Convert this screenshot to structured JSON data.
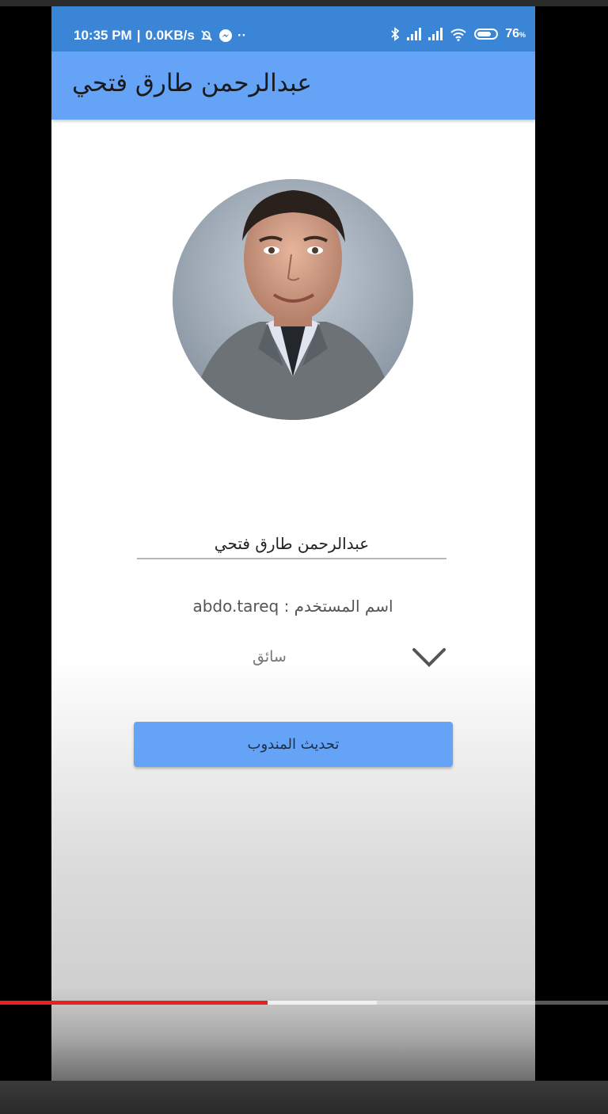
{
  "status_bar": {
    "time": "10:35 PM",
    "separator": "|",
    "network_speed": "0.0KB/s",
    "overflow_dots": "··",
    "battery_percent": "76",
    "battery_symbol": "%",
    "battery_level": 0.76,
    "icons": [
      "alarm-off-icon",
      "messenger-icon",
      "bluetooth-icon",
      "signal-icon",
      "signal-icon",
      "wifi-icon",
      "battery-icon"
    ]
  },
  "app_bar": {
    "title": "عبدالرحمن طارق فتحي"
  },
  "profile": {
    "avatar_icon": "profile-photo",
    "name_value": "عبدالرحمن طارق فتحي",
    "username_label": "اسم المستخدم :",
    "username_value": "abdo.tareq",
    "role_value": "سائق",
    "role_dropdown_icon": "chevron-down-icon",
    "update_button_label": "تحديث المندوب"
  },
  "video_player": {
    "played_fraction": 0.44,
    "buffered_fraction": 0.62,
    "played_color": "#e8201f"
  },
  "colors": {
    "status_bar": "#3a85d6",
    "app_bar": "#64a3f6",
    "button": "#64a3f6"
  }
}
